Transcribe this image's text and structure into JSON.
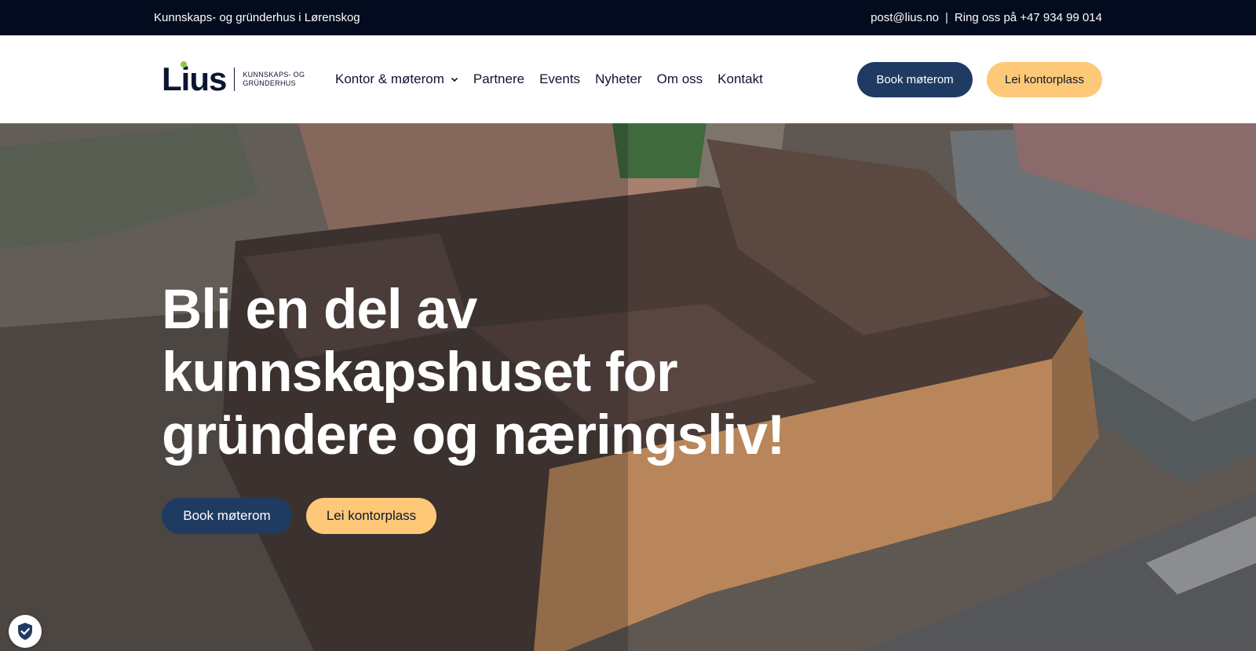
{
  "topbar": {
    "tagline": "Kunnskaps- og gründerhus i Lørenskog",
    "email": "post@lius.no",
    "separator": "|",
    "phone": "Ring oss på +47 934 99 014"
  },
  "logo": {
    "wordmark": "Lius",
    "tag_line1": "KUNNSKAPS- OG",
    "tag_line2": "GRÜNDERHUS"
  },
  "nav": {
    "items": [
      {
        "label": "Kontor & møterom",
        "dropdown": true
      },
      {
        "label": "Partnere"
      },
      {
        "label": "Events"
      },
      {
        "label": "Nyheter"
      },
      {
        "label": "Om oss"
      },
      {
        "label": "Kontakt"
      }
    ],
    "book_label": "Book møterom",
    "lease_label": "Lei kontorplass"
  },
  "hero": {
    "title_line1": "Bli en del av",
    "title_line2": "kunnskapshuset for",
    "title_line3": "gründere og næringsliv!",
    "book_label": "Book møterom",
    "lease_label": "Lei kontorplass"
  },
  "icons": {
    "chevron": "chevron-down-icon",
    "cookie": "shield-check-icon"
  },
  "colors": {
    "topbar_bg": "#030c1e",
    "primary": "#1f3b62",
    "accent": "#fdc978",
    "logo_dot": "#8dc63f"
  }
}
